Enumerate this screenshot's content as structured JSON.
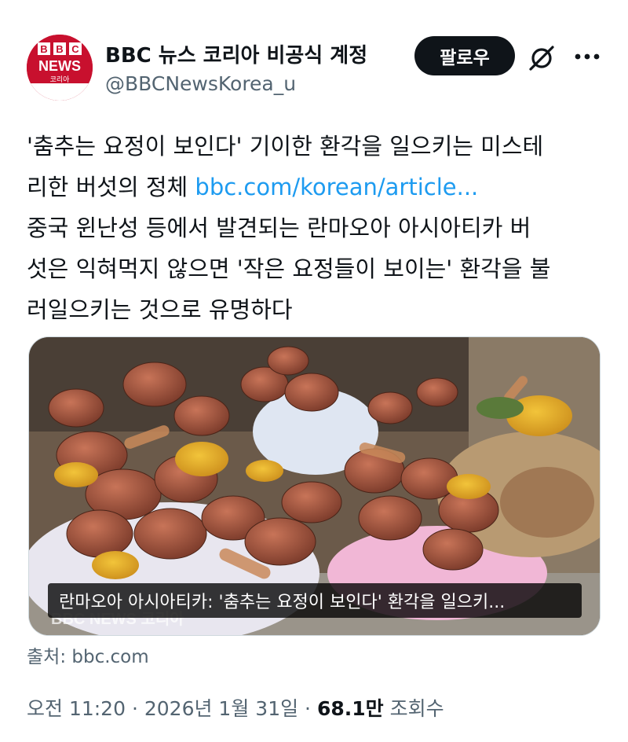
{
  "account": {
    "display_name": "BBC 뉴스 코리아 비공식 계정",
    "handle": "@BBCNewsKorea_u",
    "avatar": {
      "logo_text": "BBC",
      "sub_text": "NEWS",
      "korean_text": "코리아"
    }
  },
  "actions": {
    "follow_label": "팔로우",
    "grok_icon": "grok-slash-icon",
    "more_icon": "more-dots-icon"
  },
  "tweet": {
    "line1": "'춤추는 요정이 보인다' 기이한 환각을 일으키는 미스테",
    "line2_text": "리한 버섯의 정체 ",
    "line2_link": "bbc.com/korean/article...",
    "line3": "중국 윈난성 등에서 발견되는 란마오아 아시아티카 버",
    "line4": "섯은 익혀먹지 않으면 '작은 요정들이 보이는' 환각을 불",
    "line5": "러일으키는 것으로 유명하다"
  },
  "media": {
    "caption": "란마오아 아시아티카: '춤추는 요정이 보인다' 환각을 일으키...",
    "watermark": "BBC NEWS 코리아"
  },
  "card_source": "출처: bbc.com",
  "meta": {
    "time": "오전 11:20",
    "separator": "·",
    "date": "2026년 1월 31일",
    "views_count": "68.1만",
    "views_label": "조회수"
  },
  "colors": {
    "link": "#1d9bf0",
    "follow_bg": "#0f1419",
    "secondary_text": "#536471",
    "bbc_red": "#c8102e"
  }
}
